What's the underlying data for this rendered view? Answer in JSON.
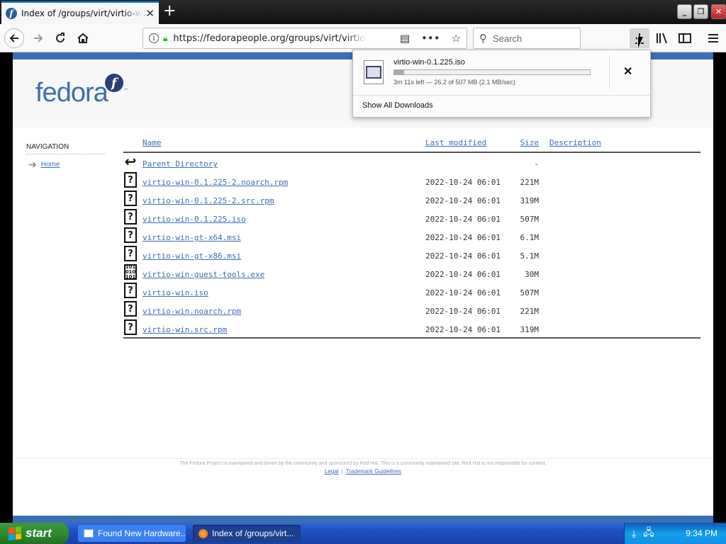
{
  "browser": {
    "tab_title": "Index of /groups/virt/virtio-win/direct-downloads",
    "url": "https://fedorapeople.org/groups/virt/virtio-win/direct-downloads",
    "search_placeholder": "Search",
    "tab_close": "✕",
    "new_tab": "+"
  },
  "downloads_panel": {
    "file_name": "virtio-win-0.1.225.iso",
    "status": "3m 11s left — 26.2 of 507 MB (2.1 MB/sec)",
    "progress": 0.052,
    "show_all_label": "Show All Downloads",
    "cancel_label": "✕"
  },
  "page": {
    "logo_text": "fedora",
    "logo_tm": "™",
    "nav_title": "NAVIGATION",
    "nav_home": "Home",
    "headers": {
      "name": "Name",
      "modified": "Last modified",
      "size": "Size",
      "description": "Description"
    },
    "parent": {
      "name": "Parent Directory",
      "size": "-"
    },
    "files": [
      {
        "name": "virtio-win-0.1.225-2.noarch.rpm",
        "modified": "2022-10-24 06:01",
        "size": "221M",
        "icon": "unknown-file-icon"
      },
      {
        "name": "virtio-win-0.1.225-2.src.rpm",
        "modified": "2022-10-24 06:01",
        "size": "319M",
        "icon": "unknown-file-icon"
      },
      {
        "name": "virtio-win-0.1.225.iso",
        "modified": "2022-10-24 06:01",
        "size": "507M",
        "icon": "unknown-file-icon"
      },
      {
        "name": "virtio-win-gt-x64.msi",
        "modified": "2022-10-24 06:01",
        "size": "6.1M",
        "icon": "unknown-file-icon"
      },
      {
        "name": "virtio-win-gt-x86.msi",
        "modified": "2022-10-24 06:01",
        "size": "5.1M",
        "icon": "unknown-file-icon"
      },
      {
        "name": "virtio-win-guest-tools.exe",
        "modified": "2022-10-24 06:01",
        "size": "30M",
        "icon": "binary-file-icon"
      },
      {
        "name": "virtio-win.iso",
        "modified": "2022-10-24 06:01",
        "size": "507M",
        "icon": "unknown-file-icon"
      },
      {
        "name": "virtio-win.noarch.rpm",
        "modified": "2022-10-24 06:01",
        "size": "221M",
        "icon": "unknown-file-icon"
      },
      {
        "name": "virtio-win.src.rpm",
        "modified": "2022-10-24 06:01",
        "size": "319M",
        "icon": "unknown-file-icon"
      }
    ],
    "footer_text": "The Fedora Project is maintained and driven by the community and sponsored by Red Hat. This is a community maintained site. Red Hat is not responsible for content.",
    "footer_legal": "Legal",
    "footer_trademark": "Trademark Guidelines"
  },
  "taskbar": {
    "start_label": "start",
    "tasks": [
      "Found New Hardware...",
      "Index of /groups/virt..."
    ],
    "clock": "9:34 PM"
  },
  "colors": {
    "fedora_blue": "#3c6eb4",
    "xp_taskbar": "#245edb",
    "xp_start_green": "#2f8a2f"
  }
}
